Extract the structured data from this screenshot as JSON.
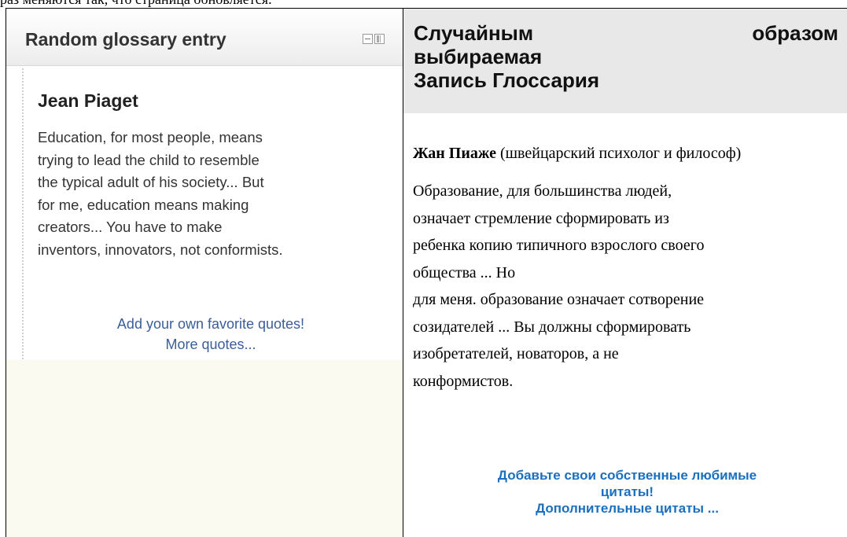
{
  "top_fragment": "раз меняются так, что страница обновляется.",
  "left_block": {
    "title": "Random glossary entry",
    "controls": {
      "hide_icon": "minus-box-icon",
      "dock_icon": "dock-icon"
    },
    "entry_name": "Jean Piaget",
    "entry_lines": [
      "Education, for most people, means",
      "trying to lead the child to resemble",
      "the typical adult of his society... But",
      "for me, education means making",
      "creators... You have to make",
      "inventors, innovators, not conformists."
    ],
    "link_add": "Add your own favorite quotes!",
    "link_more": "More quotes..."
  },
  "right_block": {
    "title_line1_a": "Случайным",
    "title_line1_b": "образом",
    "title_line2": "выбираемая",
    "title_line3": "Запись Глоссария",
    "entry_name": "Жан Пиаже",
    "entry_desc": " (швейцарский психолог и философ)",
    "quote_lines": [
      "Образование, для большинства людей,",
      "означает стремление сформировать из",
      "ребенка копию типичного взрослого своего",
      "общества ... Но",
      "для меня. образование означает сотворение",
      "созидателей ... Вы должны сформировать",
      "изобретателей, новаторов, а не",
      "конформистов."
    ],
    "link_add_1": "Добавьте свои собственные любимые",
    "link_add_2": "цитаты!",
    "link_more": "Дополнительные цитаты ..."
  },
  "colors": {
    "left_link": "#3a5e9a",
    "right_link": "#1a6fbf",
    "right_header_bg": "#e8e8e8",
    "left_cell_bg": "#fafaf0"
  }
}
